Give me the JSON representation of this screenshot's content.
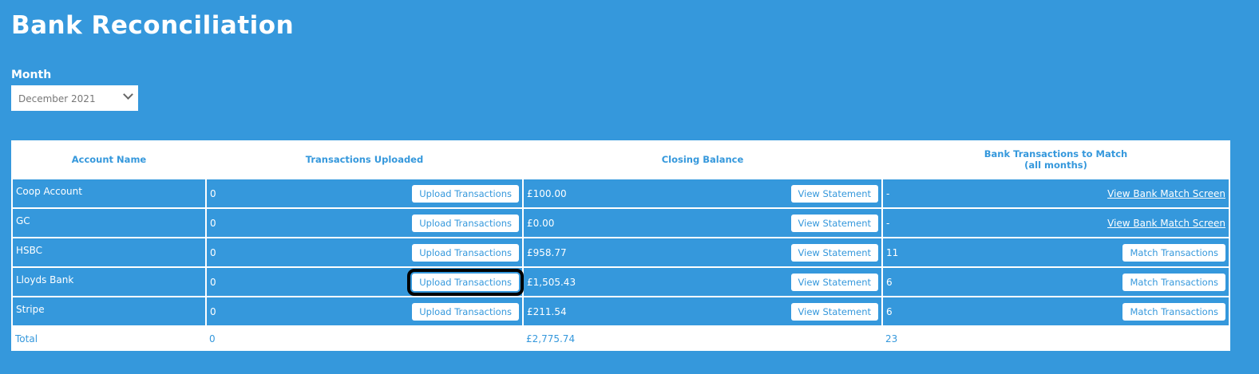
{
  "title": "Bank Reconciliation",
  "month": {
    "label": "Month",
    "value": "December 2021"
  },
  "table": {
    "headers": [
      "Account Name",
      "Transactions Uploaded",
      "Closing Balance",
      "Bank Transactions to Match",
      "(all months)"
    ],
    "rows": [
      {
        "name": "Coop Account",
        "uploaded": "0",
        "upload_btn": "Upload Transactions",
        "balance": "£100.00",
        "statement_btn": "View Statement",
        "to_match": "-",
        "action": "View Bank Match Screen"
      },
      {
        "name": "GC",
        "uploaded": "0",
        "upload_btn": "Upload Transactions",
        "balance": "£0.00",
        "statement_btn": "View Statement",
        "to_match": "-",
        "action": "View Bank Match Screen"
      },
      {
        "name": "HSBC",
        "uploaded": "0",
        "upload_btn": "Upload Transactions",
        "balance": "£958.77",
        "statement_btn": "View Statement",
        "to_match": "11",
        "action": "Match Transactions"
      },
      {
        "name": "Lloyds Bank",
        "uploaded": "0",
        "upload_btn": "Upload Transactions",
        "balance": "£1,505.43",
        "statement_btn": "View Statement",
        "to_match": "6",
        "action": "Match Transactions"
      },
      {
        "name": "Stripe",
        "uploaded": "0",
        "upload_btn": "Upload Transactions",
        "balance": "£211.54",
        "statement_btn": "View Statement",
        "to_match": "6",
        "action": "Match Transactions"
      }
    ],
    "total": {
      "label": "Total",
      "uploaded": "0",
      "balance": "£2,775.74",
      "to_match": "23"
    }
  }
}
